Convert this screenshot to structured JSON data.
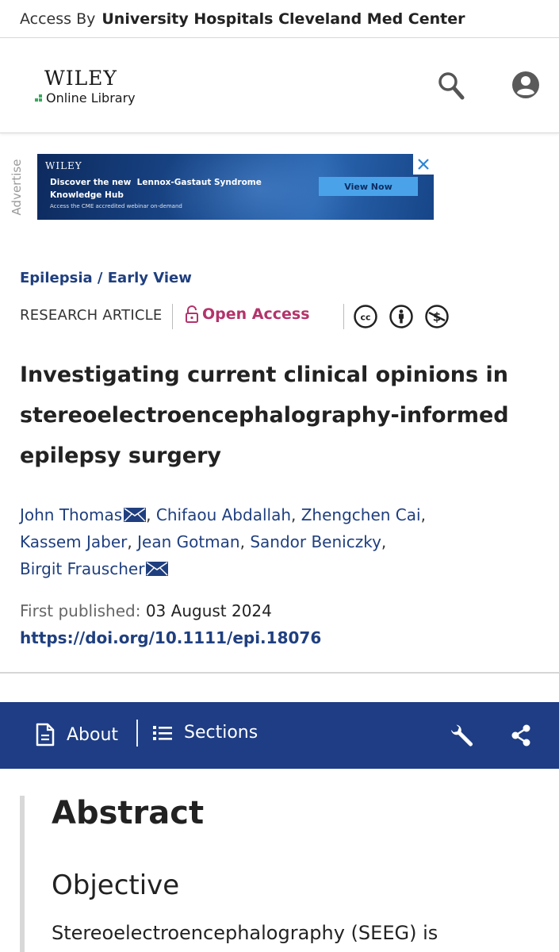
{
  "access": {
    "prefix": "Access By",
    "institution": "University Hospitals Cleveland Med Center"
  },
  "header": {
    "logo_brand": "WILEY",
    "logo_sub": "Online Library",
    "icons": {
      "search": "search-icon",
      "account": "account-icon"
    }
  },
  "ad": {
    "label": "Advertise",
    "brand": "WILEY",
    "headline_1": "Discover the new  Lennox-Gastaut Syndrome",
    "headline_2": "Knowledge Hub",
    "sub": "Access the CME accredited webinar on-demand",
    "cta": "View Now"
  },
  "article": {
    "breadcrumb": "Epilepsia / Early View",
    "type": "RESEARCH ARTICLE",
    "open_access": "Open Access",
    "license_icons": [
      "cc-icon",
      "by-icon",
      "nc-icon"
    ],
    "title": "Investigating current clinical opinions in stereoelectroencephalography-informed epilepsy surgery",
    "authors": [
      "John Thomas",
      "Chifaou Abdallah",
      "Zhengchen Cai",
      "Kassem Jaber",
      "Jean Gotman",
      "Sandor Beniczky",
      "Birgit Frauscher"
    ],
    "first_published_label": "First published:",
    "first_published_date": "03 August 2024",
    "doi": "https://doi.org/10.1111/epi.18076"
  },
  "nav": {
    "about": "About",
    "sections": "Sections",
    "icons": {
      "tools": "wrench-icon",
      "share": "share-icon"
    }
  },
  "abstract": {
    "heading": "Abstract",
    "subheading": "Objective",
    "text": "Stereoelectroencephalography (SEEG) is"
  },
  "colors": {
    "link": "#1f3f7f",
    "open_access": "#b3336b",
    "nav_bar": "#1e3d84",
    "logo_green": "#3aa85e"
  }
}
